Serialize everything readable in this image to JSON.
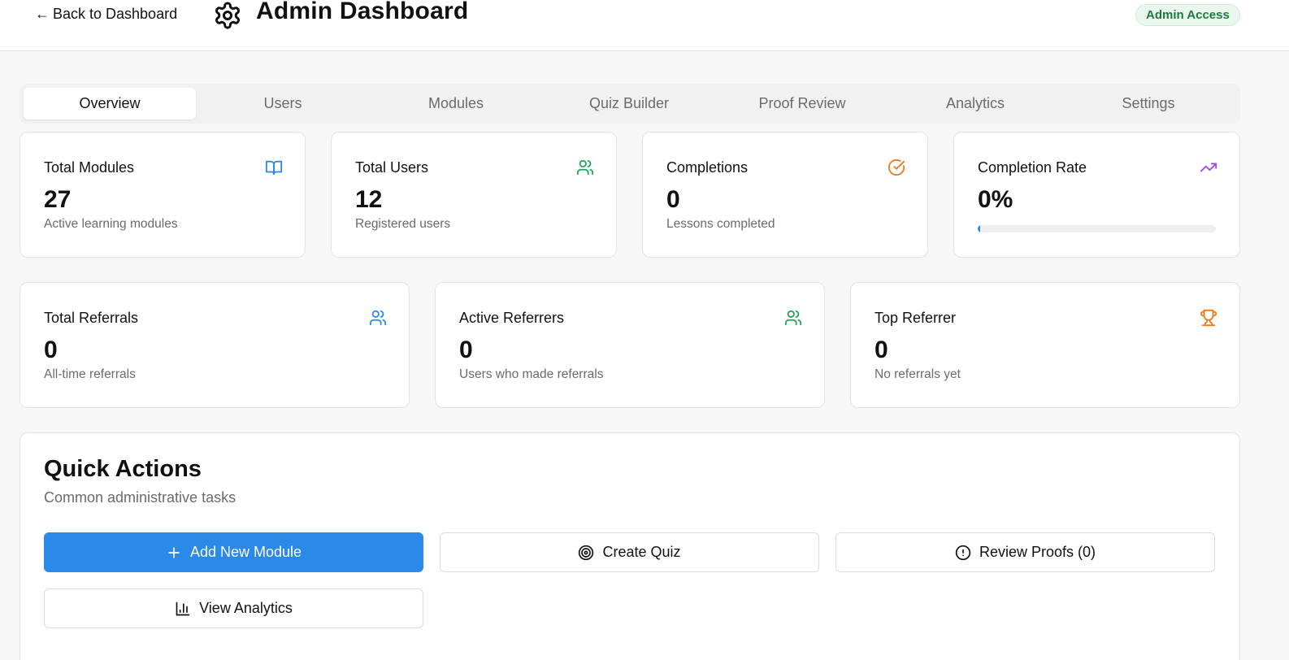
{
  "header": {
    "back_label": "Back to Dashboard",
    "back_arrow": "←",
    "title": "Admin Dashboard",
    "badge": "Admin Access"
  },
  "tabs": [
    {
      "label": "Overview",
      "active": true
    },
    {
      "label": "Users"
    },
    {
      "label": "Modules"
    },
    {
      "label": "Quiz Builder"
    },
    {
      "label": "Proof Review"
    },
    {
      "label": "Analytics"
    },
    {
      "label": "Settings"
    }
  ],
  "stats": [
    {
      "label": "Total Modules",
      "value": "27",
      "sub": "Active learning modules",
      "icon": "book-icon",
      "color": "#2b8ae8"
    },
    {
      "label": "Total Users",
      "value": "12",
      "sub": "Registered users",
      "icon": "users-icon",
      "color": "#22a35a"
    },
    {
      "label": "Completions",
      "value": "0",
      "sub": "Lessons completed",
      "icon": "check-circle-icon",
      "color": "#f07a1a"
    },
    {
      "label": "Completion Rate",
      "value": "0%",
      "icon": "trending-up-icon",
      "color": "#9b4de0",
      "progress": 0.01
    }
  ],
  "referrals": [
    {
      "label": "Total Referrals",
      "value": "0",
      "sub": "All-time referrals",
      "icon": "users-icon",
      "color": "#2b8ae8"
    },
    {
      "label": "Active Referrers",
      "value": "0",
      "sub": "Users who made referrals",
      "icon": "users-icon",
      "color": "#22a35a"
    },
    {
      "label": "Top Referrer",
      "value": "0",
      "sub": "No referrals yet",
      "icon": "trophy-icon",
      "color": "#f07a1a"
    }
  ],
  "quick_actions": {
    "title": "Quick Actions",
    "subtitle": "Common administrative tasks",
    "buttons": [
      {
        "label": "Add New Module",
        "icon": "plus-icon"
      },
      {
        "label": "Create Quiz",
        "icon": "target-icon"
      },
      {
        "label": "Review Proofs (0)",
        "icon": "alert-circle-icon"
      },
      {
        "label": "View Analytics",
        "icon": "bar-chart-icon"
      }
    ]
  }
}
